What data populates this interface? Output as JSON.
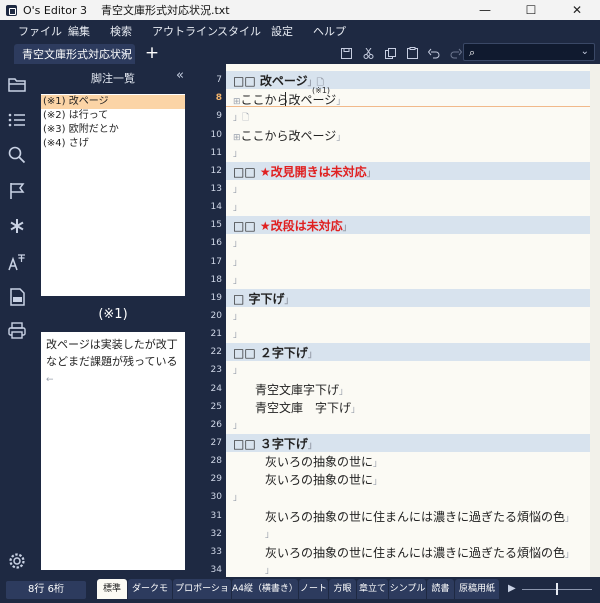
{
  "window": {
    "app_name": "O's Editor 3",
    "file_name": "青空文庫形式対応状況.txt",
    "controls": {
      "minimize": "—",
      "maximize": "☐",
      "close": "✕"
    }
  },
  "menu": [
    "ファイル",
    "編集",
    "検索",
    "アウトライン",
    "スタイル",
    "設定",
    "ヘルプ"
  ],
  "tabs": [
    {
      "label": "青空文庫形式対応状況",
      "close": "×"
    }
  ],
  "tab_add": "+",
  "toolbar_icons": [
    "save-icon",
    "cut-icon",
    "copy-icon",
    "paste-icon",
    "undo-icon",
    "redo-icon"
  ],
  "search": {
    "value": "",
    "icon": "⌕",
    "arrow": "⌄"
  },
  "rail_icons": [
    "folder-icon",
    "list-icon",
    "search-icon",
    "flag-icon",
    "asterisk-icon",
    "ruby-icon",
    "pdf-icon",
    "print-icon",
    "settings-icon"
  ],
  "sidebar": {
    "title": "脚注一覧",
    "collapse": "«",
    "footnotes": [
      "(※1) 改ページ",
      "(※2) は行って",
      "(※3) 欧附だとか",
      "(※4) さげ"
    ],
    "selected_index": 0,
    "marker": "(※1)",
    "detail": "改ページは実装したが改丁などまだ課題が残っている",
    "detail_end_mark": "←"
  },
  "editor": {
    "current_line": 8,
    "lines": [
      {
        "n": "7",
        "text": "□□ 改ページ",
        "head": true
      },
      {
        "n": "8",
        "text": "ここから改ページ",
        "ruby": "(※1)"
      },
      {
        "n": "9",
        "text": ""
      },
      {
        "n": "10",
        "text": "ここから改ページ"
      },
      {
        "n": "11",
        "text": ""
      },
      {
        "n": "12",
        "text": "□□ ",
        "red": "★改見開きは未対応",
        "head": true
      },
      {
        "n": "13",
        "text": ""
      },
      {
        "n": "14",
        "text": ""
      },
      {
        "n": "15",
        "text": "□□ ",
        "red": "★改段は未対応",
        "head": true
      },
      {
        "n": "16",
        "text": ""
      },
      {
        "n": "17",
        "text": ""
      },
      {
        "n": "18",
        "text": ""
      },
      {
        "n": "19",
        "text": "□ 字下げ",
        "head": true
      },
      {
        "n": "20",
        "text": ""
      },
      {
        "n": "21",
        "text": ""
      },
      {
        "n": "22",
        "text": "□□ ２字下げ",
        "head": true
      },
      {
        "n": "23",
        "text": ""
      },
      {
        "n": "24",
        "text": "青空文庫字下げ"
      },
      {
        "n": "25",
        "text": "青空文庫　字下げ"
      },
      {
        "n": "26",
        "text": ""
      },
      {
        "n": "27",
        "text": "□□ ３字下げ",
        "head": true
      },
      {
        "n": "28",
        "text": "灰いろの抽象の世に"
      },
      {
        "n": "29",
        "text": "灰いろの抽象の世に"
      },
      {
        "n": "30",
        "text": ""
      },
      {
        "n": "31",
        "text": "灰いろの抽象の世に住まんには濃きに過ぎたる煩悩の色"
      },
      {
        "n": "32",
        "text": ""
      },
      {
        "n": "33",
        "text": "灰いろの抽象の世に住まんには濃きに過ぎたる煩悩の色"
      },
      {
        "n": "34",
        "text": ""
      }
    ],
    "line_end_mark": "」",
    "page_mark": "🗋",
    "pagebreak_mark": "⊞"
  },
  "status": {
    "position": "8行  6桁",
    "styles": [
      "標準",
      "ダークモード",
      "プロポーショナル",
      "A4縦（横書き）",
      "ノート",
      "方眼",
      "章立て",
      "シンプル",
      "読書",
      "原稿用紙"
    ],
    "active_style": 0,
    "arrow": "▶"
  }
}
